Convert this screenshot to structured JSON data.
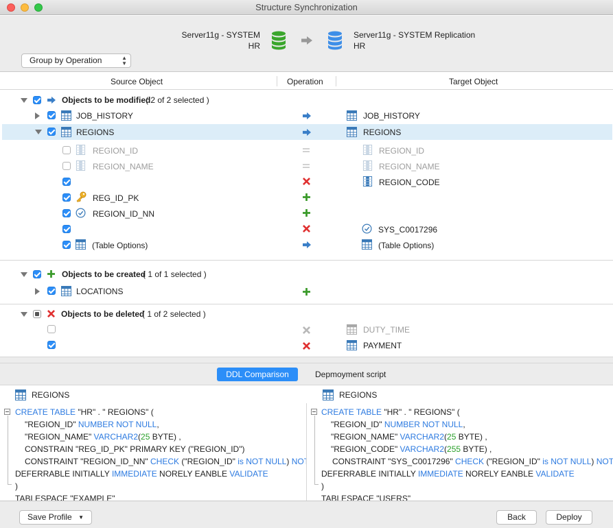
{
  "window": {
    "title": "Structure Synchronization"
  },
  "source_server": {
    "name": "Server11g - SYSTEM",
    "schema": "HR"
  },
  "target_server": {
    "name": "Server11g - SYSTEM Replication",
    "schema": "HR"
  },
  "group_select": {
    "value": "Group by Operation"
  },
  "columns": {
    "source": "Source Object",
    "operation": "Operation",
    "target": "Target Object"
  },
  "sections": {
    "modified": {
      "label": "Objects to be modified",
      "count": "( 2 of 2 selected )",
      "rows": {
        "job_history": {
          "source": "JOB_HISTORY",
          "target": "JOB_HISTORY"
        },
        "regions": {
          "source": "REGIONS",
          "target": "REGIONS",
          "children": {
            "c1": {
              "source": "REGION_ID",
              "target": "REGION_ID"
            },
            "c2": {
              "source": "REGION_NAME",
              "target": "REGION_NAME"
            },
            "c3": {
              "source": "",
              "target": "REGION_CODE"
            },
            "c4": {
              "source": "REG_ID_PK",
              "target": ""
            },
            "c5": {
              "source": "REGION_ID_NN",
              "target": ""
            },
            "c6": {
              "source": "",
              "target": "SYS_C0017296"
            },
            "c7": {
              "source": "(Table Options)",
              "target": "(Table Options)"
            }
          }
        }
      }
    },
    "created": {
      "label": "Objects to be created",
      "count": "( 1 of 1 selected )",
      "rows": {
        "locations": {
          "source": "LOCATIONS",
          "target": ""
        }
      }
    },
    "deleted": {
      "label": "Objects to be deleted",
      "count": "( 1 of 2 selected )",
      "rows": {
        "duty_time": {
          "source": "",
          "target": "DUTY_TIME"
        },
        "payment": {
          "source": "",
          "target": "PAYMENT"
        }
      }
    }
  },
  "tabs": {
    "ddl": "DDL Comparison",
    "deploy": "Depmoyment script"
  },
  "ddl": {
    "left": {
      "title": "REGIONS",
      "l1a": "CREATE TABLE",
      "l1b": " \"HR\" . \" REGIONS\" (",
      "l2a": "\"REGION_ID\" ",
      "l2b": "NUMBER NOT NULL",
      "l2c": ",",
      "l3a": "\"REGION_NAME\" ",
      "l3b": "VARCHAR2",
      "l3c": "(",
      "l3d": "25",
      "l3e": " BYTE) ,",
      "l4": "CONSTRAIN \"REG_ID_PK\" PRIMARY KEY (\"REGION_ID\")",
      "l5a": "CONSTRAINT \"REGION_ID_NN\" ",
      "l5b": "CHECK",
      "l5c": " (\"REGION_ID\" ",
      "l5d": "is NOT NULL",
      "l5e": ") ",
      "l5f": "NOT",
      "l6a": "DEFERRABLE INITIALLY ",
      "l6b": "IMMEDIATE",
      "l6c": " NORELY EANBLE ",
      "l6d": "VALIDATE",
      "l7": ")",
      "l8": "TABLESPACE \"EXAMPLE\""
    },
    "right": {
      "title": "REGIONS",
      "l1a": "CREATE TABLE",
      "l1b": " \"HR\" . \" REGIONS\" (",
      "l2a": "\"REGION_ID\" ",
      "l2b": "NUMBER NOT NULL",
      "l2c": ",",
      "l3a": "\"REGION_NAME\" ",
      "l3b": "VARCHAR2",
      "l3c": "(",
      "l3d": "25",
      "l3e": " BYTE) ,",
      "l4a": "\"REGION_CODE\" ",
      "l4b": "VARCHAR2",
      "l4c": "(",
      "l4d": "255",
      "l4e": " BYTE) ,",
      "l5a": "CONSTRAINT \"SYS_C0017296\" ",
      "l5b": "CHECK",
      "l5c": " (\"REGION_ID\" ",
      "l5d": "is NOT NULL",
      "l5e": ") ",
      "l5f": "NOT",
      "l6a": "DEFERRABLE INITIALLY ",
      "l6b": "IMMEDIATE",
      "l6c": " NORELY EANBLE ",
      "l6d": "VALIDATE",
      "l7": ")",
      "l8": "TABLESPACE \"USERS\""
    }
  },
  "footer": {
    "save_profile": "Save Profile",
    "back": "Back",
    "deploy": "Deploy"
  },
  "colors": {
    "accent": "#2c8ef8",
    "source_db": "#3aa62c",
    "target_db": "#3d8ee8",
    "delete": "#e03030",
    "add": "#3a9a2a",
    "modify": "#3a7fc8"
  }
}
